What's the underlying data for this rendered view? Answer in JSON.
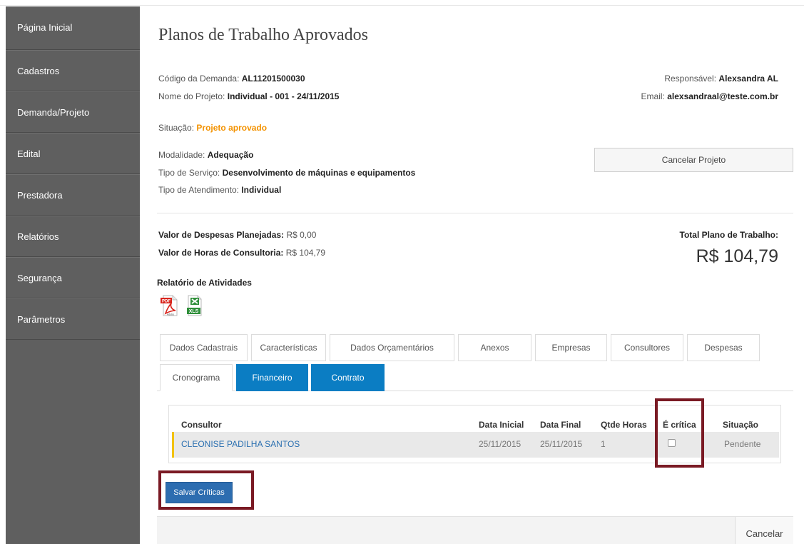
{
  "sidebar": {
    "items": [
      {
        "label": "Página Inicial"
      },
      {
        "label": "Cadastros"
      },
      {
        "label": "Demanda/Projeto"
      },
      {
        "label": "Edital"
      },
      {
        "label": "Prestadora"
      },
      {
        "label": "Relatórios"
      },
      {
        "label": "Segurança"
      },
      {
        "label": "Parâmetros"
      }
    ]
  },
  "page": {
    "title": "Planos de Trabalho Aprovados"
  },
  "details": {
    "codigo_label": "Código da Demanda:",
    "codigo_value": "AL11201500030",
    "projeto_label": "Nome do Projeto:",
    "projeto_value": "Individual - 001 - 24/11/2015",
    "responsavel_label": "Responsável:",
    "responsavel_value": "Alexsandra AL",
    "email_label": "Email:",
    "email_value": "alexsandraal@teste.com.br",
    "situacao_label": "Situação:",
    "situacao_value": "Projeto aprovado",
    "modalidade_label": "Modalidade:",
    "modalidade_value": "Adequação",
    "servico_label": "Tipo de Serviço:",
    "servico_value": "Desenvolvimento de máquinas e equipamentos",
    "atendimento_label": "Tipo de Atendimento:",
    "atendimento_value": "Individual",
    "cancel_project_label": "Cancelar Projeto"
  },
  "values": {
    "despesas_label": "Valor de Despesas Planejadas:",
    "despesas_value": "R$ 0,00",
    "horas_label": "Valor de Horas de Consultoria:",
    "horas_value": "R$ 104,79",
    "total_label": "Total Plano de Trabalho:",
    "total_value": "R$ 104,79"
  },
  "report": {
    "title": "Relatório de Atividades",
    "pdf_badge": "PDF",
    "pdf_sub": "Adobe",
    "xls_badge": "XLS"
  },
  "tabs": {
    "row1": [
      "Dados Cadastrais",
      "Características",
      "Dados Orçamentários",
      "Anexos",
      "Empresas",
      "Consultores",
      "Despesas"
    ],
    "row2": [
      "Cronograma",
      "Financeiro",
      "Contrato"
    ]
  },
  "table": {
    "headers": [
      "Consultor",
      "Data Inicial",
      "Data Final",
      "Qtde Horas",
      "É crítica",
      "Situação"
    ],
    "rows": [
      {
        "consultor": "CLEONISE PADILHA SANTOS",
        "data_inicial": "25/11/2015",
        "data_final": "25/11/2015",
        "qtde_horas": "1",
        "critica": false,
        "situacao": "Pendente"
      }
    ]
  },
  "actions": {
    "save_label": "Salvar Críticas",
    "cancel_label": "Cancelar"
  },
  "colors": {
    "sidebar_bg": "#5f5f5f",
    "status_orange": "#f39200",
    "tab_blue": "#0b7dc3",
    "highlight_red": "#7a1a24",
    "save_blue": "#2d6db0"
  }
}
